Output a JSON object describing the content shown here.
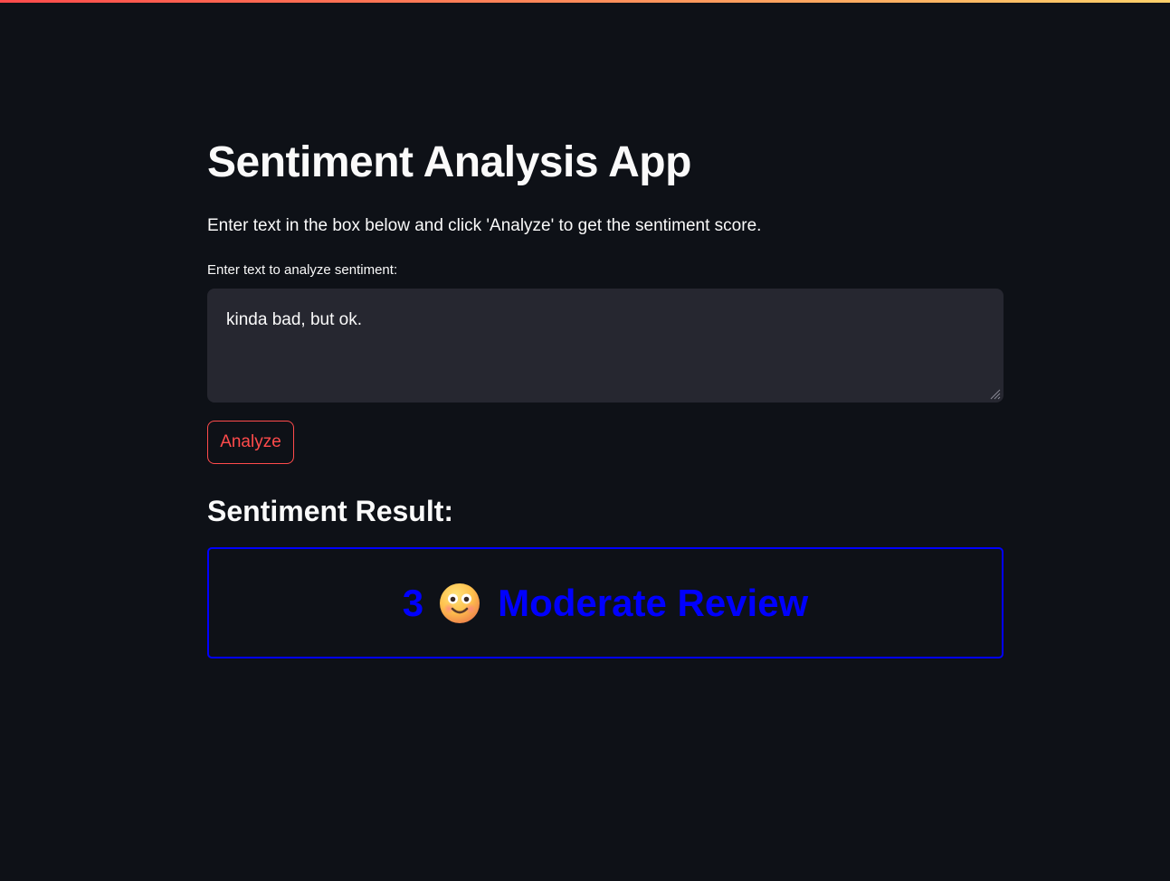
{
  "app": {
    "title": "Sentiment Analysis App",
    "intro": "Enter text in the box below and click 'Analyze' to get the sentiment score.",
    "accent_color": "#ff4b4b",
    "background_color": "#0e1117"
  },
  "input": {
    "label": "Enter text to analyze sentiment:",
    "value": "kinda bad, but ok."
  },
  "actions": {
    "analyze_label": "Analyze"
  },
  "result": {
    "heading": "Sentiment Result:",
    "score": "3",
    "emoji_icon": "smiling-face-emoji-icon",
    "label": "Moderate Review",
    "color": "#0000ff"
  }
}
